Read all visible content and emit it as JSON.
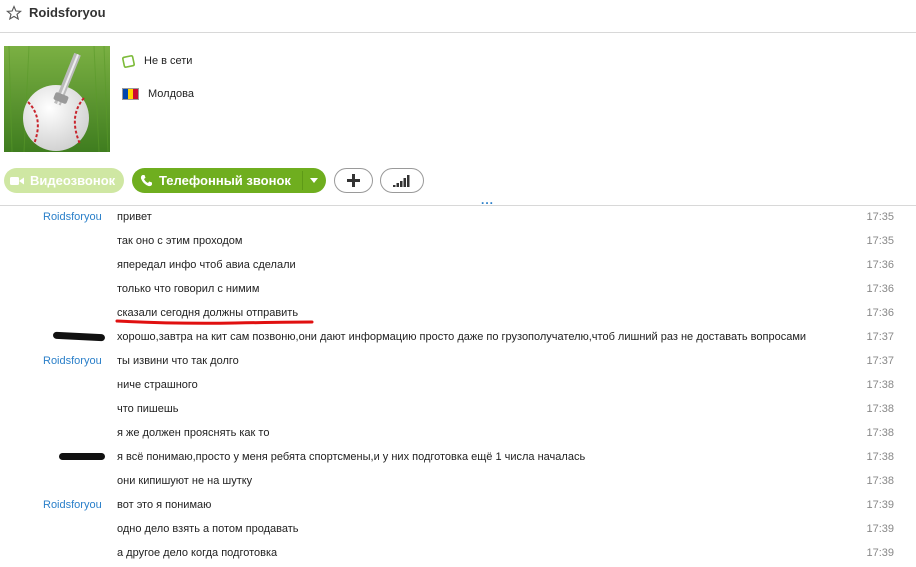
{
  "header": {
    "contact_name": "Roidsforyou"
  },
  "profile": {
    "status": "Не в сети",
    "country": "Молдова"
  },
  "buttons": {
    "video_call": "Видеозвонок",
    "phone_call": "Телефонный звонок"
  },
  "colors": {
    "accent_green": "#6fae1f",
    "link_blue": "#2a7fc9",
    "flag_blue": "#0046ae",
    "flag_yellow": "#ffd200",
    "flag_red": "#cc092f",
    "annotation_red": "#e01010"
  },
  "messages": [
    {
      "sender": "Roidsforyou",
      "text": "привет",
      "time": "17:35"
    },
    {
      "sender": "",
      "text": "так оно с этим проходом",
      "time": "17:35"
    },
    {
      "sender": "",
      "text": " япередал инфо чтоб авиа сделали",
      "time": "17:36"
    },
    {
      "sender": "",
      "text": "только что говорил с нимим",
      "time": "17:36"
    },
    {
      "sender": "",
      "text": "сказали сегодня должны отправить",
      "time": "17:36",
      "underlined": true
    },
    {
      "sender": "",
      "text": "хорошо,завтра на кит сам позвоню,они дают информацию просто даже по грузополучателю,чтоб лишний раз не доставать вопросами",
      "time": "17:37",
      "redacted_sender": true
    },
    {
      "sender": "Roidsforyou",
      "text": "ты извини что так долго",
      "time": "17:37"
    },
    {
      "sender": "",
      "text": "ниче страшного",
      "time": "17:38"
    },
    {
      "sender": "",
      "text": "что пишешь",
      "time": "17:38"
    },
    {
      "sender": "",
      "text": "я же должен прояснять как то",
      "time": "17:38"
    },
    {
      "sender": "",
      "text": "я всё понимаю,просто у меня ребята спортсмены,и у них подготовка ещё 1 числа началась",
      "time": "17:38",
      "redacted_sender": true
    },
    {
      "sender": "",
      "text": "они кипишуют не на шутку",
      "time": "17:38"
    },
    {
      "sender": "Roidsforyou",
      "text": "вот это я понимаю",
      "time": "17:39"
    },
    {
      "sender": "",
      "text": "одно дело взять а потом продавать",
      "time": "17:39"
    },
    {
      "sender": "",
      "text": "а другое дело когда подготовка",
      "time": "17:39"
    }
  ]
}
